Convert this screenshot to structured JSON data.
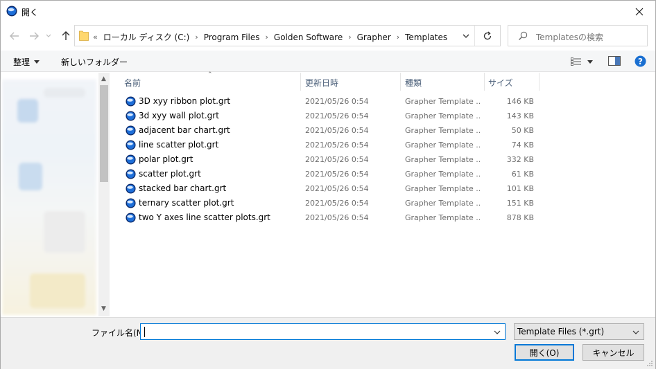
{
  "window": {
    "title": "開く"
  },
  "nav": {
    "breadcrumbs": [
      "ローカル ディスク (C:)",
      "Program Files",
      "Golden Software",
      "Grapher",
      "Templates"
    ],
    "overflow": "«"
  },
  "search": {
    "placeholder": "Templatesの検索"
  },
  "toolbar": {
    "organize_label": "整理",
    "new_folder_label": "新しいフォルダー"
  },
  "columns": {
    "name": "名前",
    "date": "更新日時",
    "type": "種類",
    "size": "サイズ"
  },
  "files": [
    {
      "name": "3D xyy ribbon plot.grt",
      "date": "2021/05/26 0:54",
      "type": "Grapher Template ...",
      "size": "146 KB"
    },
    {
      "name": "3d xyy wall plot.grt",
      "date": "2021/05/26 0:54",
      "type": "Grapher Template ...",
      "size": "143 KB"
    },
    {
      "name": "adjacent bar chart.grt",
      "date": "2021/05/26 0:54",
      "type": "Grapher Template ...",
      "size": "50 KB"
    },
    {
      "name": "line scatter plot.grt",
      "date": "2021/05/26 0:54",
      "type": "Grapher Template ...",
      "size": "74 KB"
    },
    {
      "name": "polar plot.grt",
      "date": "2021/05/26 0:54",
      "type": "Grapher Template ...",
      "size": "332 KB"
    },
    {
      "name": "scatter plot.grt",
      "date": "2021/05/26 0:54",
      "type": "Grapher Template ...",
      "size": "61 KB"
    },
    {
      "name": "stacked bar chart.grt",
      "date": "2021/05/26 0:54",
      "type": "Grapher Template ...",
      "size": "101 KB"
    },
    {
      "name": "ternary scatter plot.grt",
      "date": "2021/05/26 0:54",
      "type": "Grapher Template ...",
      "size": "151 KB"
    },
    {
      "name": "two Y axes line scatter plots.grt",
      "date": "2021/05/26 0:54",
      "type": "Grapher Template ...",
      "size": "878 KB"
    }
  ],
  "footer": {
    "filename_label": "ファイル名(N):",
    "filename_value": "",
    "filter_value": "Template Files (*.grt)",
    "open_label": "開く(O)",
    "cancel_label": "キャンセル"
  },
  "colors": {
    "accent": "#0078d7",
    "header_text": "#4c607a",
    "meta_text": "#6d6d6d"
  }
}
